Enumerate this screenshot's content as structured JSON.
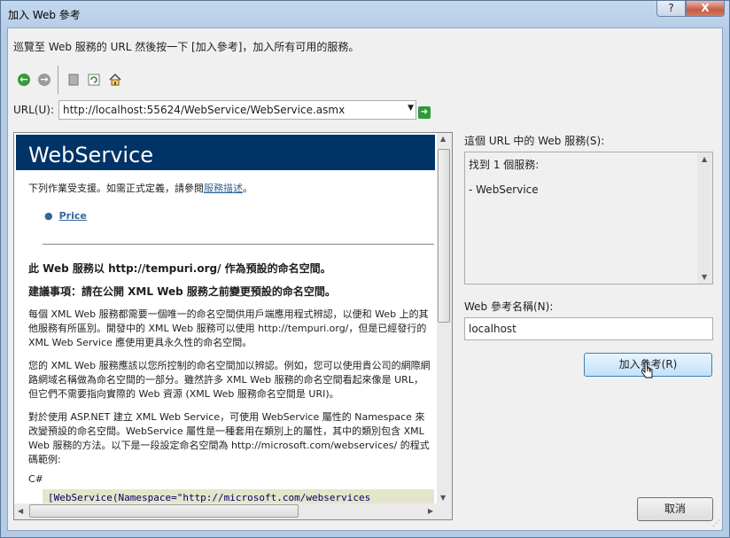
{
  "window": {
    "title": "加入 Web 參考",
    "help_label": "?",
    "close_label": "X"
  },
  "instruction": "巡覽至 Web 服務的 URL 然後按一下 [加入參考]，加入所有可用的服務。",
  "toolbar": {
    "icons": [
      "back-icon",
      "forward-icon",
      "stop-icon",
      "refresh-icon",
      "home-icon"
    ]
  },
  "url": {
    "label": "URL(U):",
    "value": "http://localhost:55624/WebService/WebService.asmx"
  },
  "browser_page": {
    "header": "WebService",
    "intro_text": "下列作業受支援。如需正式定義，請參閱",
    "intro_link": "服務描述",
    "intro_end": "。",
    "operations": [
      "Price"
    ],
    "namespace_heading": "此 Web 服務以 http://tempuri.org/ 作為預設的命名空間。",
    "recommendation_heading": "建議事項：請在公開 XML Web 服務之前變更預設的命名空間。",
    "para1": "每個 XML Web 服務都需要一個唯一的命名空間供用戶端應用程式辨認，以便和 Web 上的其他服務有所區別。開發中的 XML Web 服務可以使用 http://tempuri.org/，但是已經發行的 XML Web Service 應使用更具永久性的命名空間。",
    "para2": "您的 XML Web 服務應該以您所控制的命名空間加以辨認。例如，您可以使用貴公司的網際網路網域名稱做為命名空間的一部分。雖然許多 XML Web 服務的命名空間看起來像是 URL，但它們不需要指向實際的 Web 資源 (XML Web 服務命名空間是 URI)。",
    "para3": "對於使用 ASP.NET 建立 XML Web Service，可使用 WebService 屬性的 Namespace 來改變預設的命名空間。WebService 屬性是一種套用在類別上的屬性，其中的類別包含 XML Web 服務的方法。以下是一段設定命名空間為 http://microsoft.com/webservices/ 的程式碼範例:",
    "lang": "C#",
    "code": "[WebService(Namespace=\"http://microsoft.com/webservices"
  },
  "services_panel": {
    "label": "這個 URL 中的 Web 服務(S):",
    "found": "找到 1 個服務:",
    "items": [
      "- WebService"
    ]
  },
  "reference_name": {
    "label": "Web 參考名稱(N):",
    "value": "localhost"
  },
  "buttons": {
    "add_reference": "加入參考(R)",
    "cancel": "取消"
  },
  "colors": {
    "header_bg": "#003366",
    "link": "#336699",
    "code_bg": "#e5e5cc"
  }
}
